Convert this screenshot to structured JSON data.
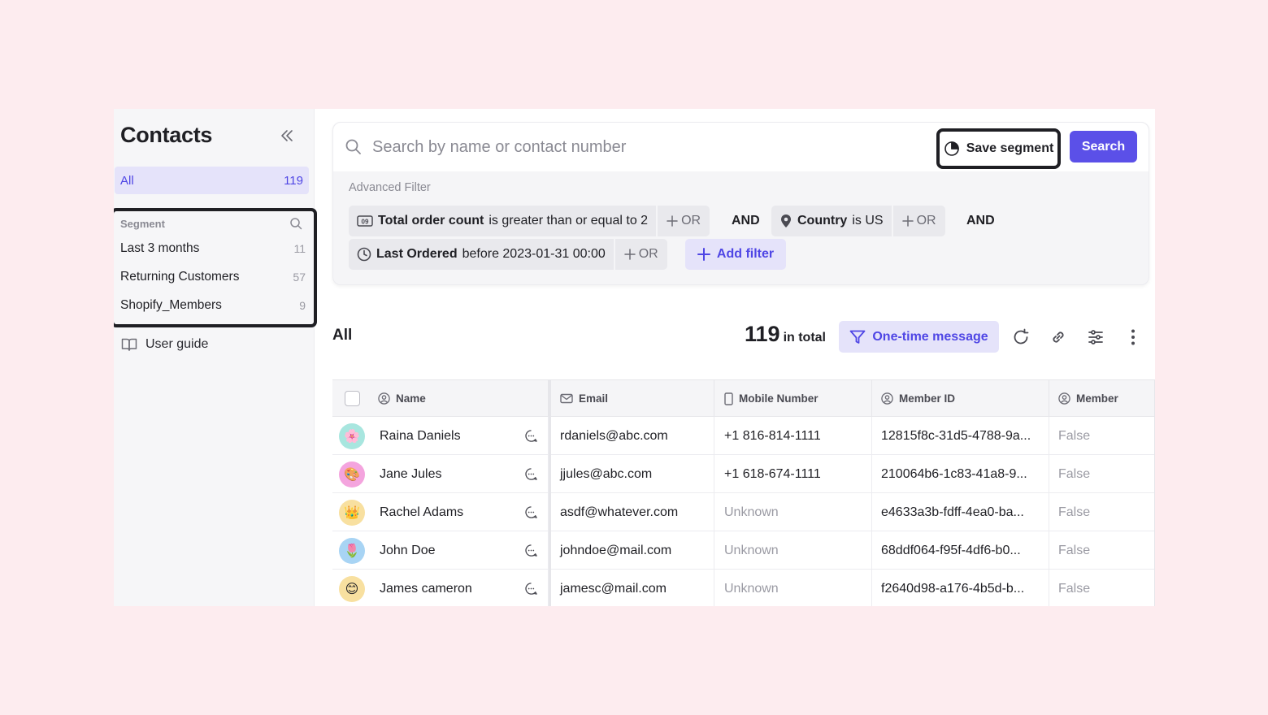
{
  "sidebar": {
    "title": "Contacts",
    "all": {
      "label": "All",
      "count": "119"
    },
    "segment": {
      "header": "Segment",
      "items": [
        {
          "label": "Last 3 months",
          "count": "11"
        },
        {
          "label": "Returning Customers",
          "count": "57"
        },
        {
          "label": "Shopify_Members",
          "count": "9"
        }
      ]
    },
    "user_guide": "User guide"
  },
  "search": {
    "placeholder": "Search by name or contact number",
    "save_segment": "Save segment",
    "search_button": "Search"
  },
  "filter": {
    "label": "Advanced Filter",
    "chips": [
      {
        "field": "Total order count",
        "condition": "is greater than or equal to 2",
        "or": "OR"
      },
      {
        "field": "Country",
        "condition": "is US",
        "or": "OR"
      },
      {
        "field": "Last Ordered",
        "condition": "before 2023-01-31 00:00",
        "or": "OR"
      }
    ],
    "and1": "AND",
    "and2": "AND",
    "add_filter": "Add filter"
  },
  "list": {
    "title": "All",
    "total": "119",
    "total_label": "in total",
    "one_time_message": "One-time message"
  },
  "table": {
    "columns": [
      "Name",
      "Email",
      "Mobile Number",
      "Member ID",
      "Member"
    ],
    "rows": [
      {
        "name": "Raina Daniels",
        "email": "rdaniels@abc.com",
        "mobile": "+1 816-814-1111",
        "member_id": "12815f8c-31d5-4788-9a...",
        "member": "False",
        "avatar": "🌸"
      },
      {
        "name": "Jane Jules",
        "email": "jjules@abc.com",
        "mobile": "+1 618-674-1111",
        "member_id": "210064b6-1c83-41a8-9...",
        "member": "False",
        "avatar": "🎨"
      },
      {
        "name": "Rachel Adams",
        "email": "asdf@whatever.com",
        "mobile": "Unknown",
        "member_id": "e4633a3b-fdff-4ea0-ba...",
        "member": "False",
        "avatar": "👑"
      },
      {
        "name": "John Doe",
        "email": "johndoe@mail.com",
        "mobile": "Unknown",
        "member_id": "68ddf064-f95f-4df6-b0...",
        "member": "False",
        "avatar": "🌷"
      },
      {
        "name": "James cameron",
        "email": "jamesc@mail.com",
        "mobile": "Unknown",
        "member_id": "f2640d98-a176-4b5d-b...",
        "member": "False",
        "avatar": "😊"
      }
    ]
  },
  "colors": {
    "accent": "#5b50e8",
    "accent_light": "#e5e3fa",
    "background": "#fdecef"
  },
  "avatar_colors": [
    "#a8e6df",
    "#f4a4de",
    "#f8e0a0",
    "#a8d4f4",
    "#f8e0a0"
  ]
}
